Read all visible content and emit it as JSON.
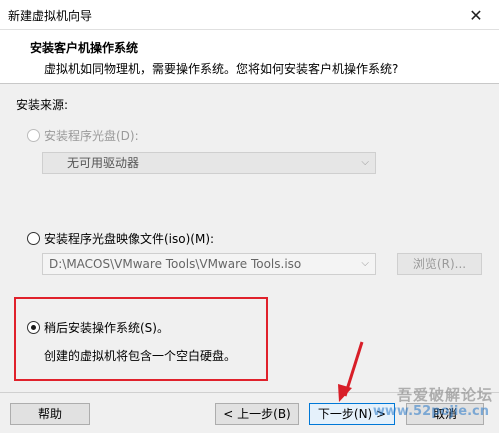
{
  "window": {
    "title": "新建虚拟机向导",
    "close_glyph": "✕"
  },
  "header": {
    "title": "安装客户机操作系统",
    "subtitle": "虚拟机如同物理机，需要操作系统。您将如何安装客户机操作系统?"
  },
  "source": {
    "label": "安装来源:",
    "options": [
      {
        "label": "安装程序光盘(D):",
        "checked": false,
        "enabled": false,
        "combo_value": "无可用驱动器"
      },
      {
        "label": "安装程序光盘映像文件(iso)(M):",
        "checked": false,
        "enabled": true,
        "path_value": "D:\\MACOS\\VMware Tools\\VMware Tools.iso",
        "browse_label": "浏览(R)..."
      },
      {
        "label": "稍后安装操作系统(S)。",
        "checked": true,
        "enabled": true,
        "description": "创建的虚拟机将包含一个空白硬盘。"
      }
    ]
  },
  "footer": {
    "help_label": "帮助",
    "back_label": "< 上一步(B)",
    "next_label": "下一步(N) >",
    "cancel_label": "取消"
  },
  "watermark": {
    "line1": "吾爱破解论坛",
    "line2": "www.52pojie.cn"
  },
  "colors": {
    "highlight_box": "#e0212b",
    "arrow": "#d81e28",
    "primary_border": "#0078d7"
  }
}
